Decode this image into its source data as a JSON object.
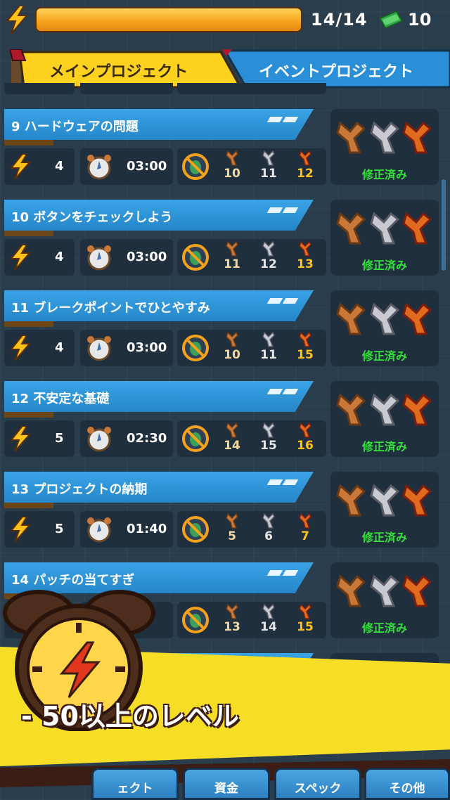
{
  "topbar": {
    "energy_value": "14/14",
    "energy_fill": 1.0,
    "cash_value": "10",
    "icons": [
      "lightning-icon",
      "cash-icon"
    ]
  },
  "tabs": {
    "main": "メインプロジェクト",
    "event": "イベントプロジェクト"
  },
  "projects": [
    {
      "title": "9  ハードウェアの問題",
      "energy": "4",
      "time": "03:00",
      "tools": [
        "10",
        "11",
        "12"
      ],
      "status": "修正済み"
    },
    {
      "title": "10  ボタンをチェックしよう",
      "energy": "4",
      "time": "03:00",
      "tools": [
        "11",
        "12",
        "13"
      ],
      "status": "修正済み"
    },
    {
      "title": "11  ブレークポイントでひとやすみ",
      "energy": "4",
      "time": "03:00",
      "tools": [
        "10",
        "11",
        "15"
      ],
      "status": "修正済み"
    },
    {
      "title": "12  不安定な基礎",
      "energy": "5",
      "time": "02:30",
      "tools": [
        "14",
        "15",
        "16"
      ],
      "status": "修正済み"
    },
    {
      "title": "13  プロジェクトの納期",
      "energy": "5",
      "time": "01:40",
      "tools": [
        "5",
        "6",
        "7"
      ],
      "status": "修正済み"
    },
    {
      "title": "14  パッチの当てすぎ",
      "energy": "",
      "time": "30",
      "tools": [
        "13",
        "14",
        "15"
      ],
      "status": "修正済み"
    }
  ],
  "promo": {
    "text": "- 50以上のレベル"
  },
  "bottom_nav": {
    "items": [
      "ェクト",
      "資金",
      "スペック",
      "その他"
    ]
  },
  "colors": {
    "accent_blue": "#2f95d8",
    "tab_yellow": "#ffd21f",
    "fixed_green": "#34e03c",
    "energy_orange": "#f7a51e"
  }
}
